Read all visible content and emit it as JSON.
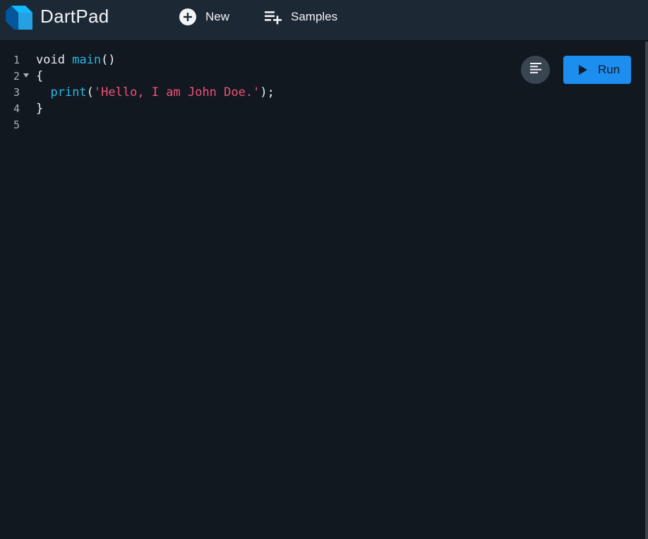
{
  "app": {
    "title": "DartPad"
  },
  "toolbar": {
    "new_label": "New",
    "new_icon": "add-circle-icon",
    "samples_label": "Samples",
    "samples_icon": "playlist-add-icon"
  },
  "editor": {
    "line_numbers": [
      "1",
      "2",
      "3",
      "4",
      "5"
    ],
    "lines": {
      "l1": {
        "keyword": "void",
        "space": " ",
        "func": "main",
        "rest": "()"
      },
      "l2": {
        "text": "{"
      },
      "l3": {
        "indent": "  ",
        "func": "print",
        "open": "(",
        "string": "'Hello, I am John Doe.'",
        "close": ");"
      },
      "l4": {
        "text": "}"
      },
      "l5": {
        "text": ""
      }
    }
  },
  "actions": {
    "format_icon": "format-align-left-icon",
    "run_label": "Run",
    "run_icon": "play-icon"
  },
  "colors": {
    "topbar": "#1c2834",
    "editor_bg": "#111820",
    "run_button": "#1c8ef0",
    "function": "#2bb7e4",
    "string": "#f05277"
  }
}
